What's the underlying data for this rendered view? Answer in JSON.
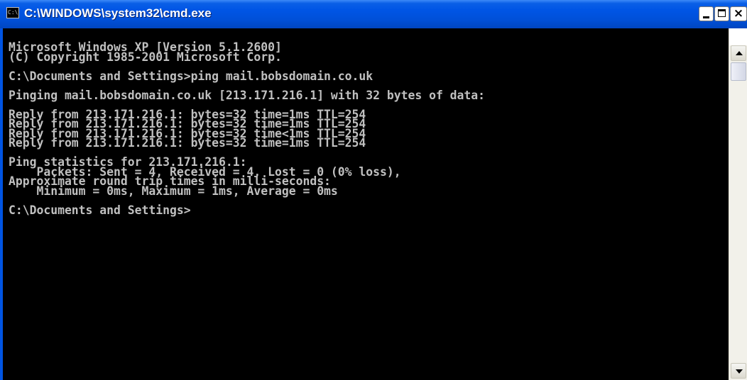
{
  "window": {
    "title": "C:\\WINDOWS\\system32\\cmd.exe",
    "icon": "cmd-icon",
    "icon_text": "C:\\",
    "buttons": {
      "minimize": "minimize-icon",
      "maximize": "maximize-icon",
      "close_label": "×"
    }
  },
  "console": {
    "lines": [
      "Microsoft Windows XP [Version 5.1.2600]",
      "(C) Copyright 1985-2001 Microsoft Corp.",
      "",
      "C:\\Documents and Settings>ping mail.bobsdomain.co.uk",
      "",
      "Pinging mail.bobsdomain.co.uk [213.171.216.1] with 32 bytes of data:",
      "",
      "Reply from 213.171.216.1: bytes=32 time=1ms TTL=254",
      "Reply from 213.171.216.1: bytes=32 time=1ms TTL=254",
      "Reply from 213.171.216.1: bytes=32 time<1ms TTL=254",
      "Reply from 213.171.216.1: bytes=32 time=1ms TTL=254",
      "",
      "Ping statistics for 213.171.216.1:",
      "    Packets: Sent = 4, Received = 4, Lost = 0 (0% loss),",
      "Approximate round trip times in milli-seconds:",
      "    Minimum = 0ms, Maximum = 1ms, Average = 0ms",
      "",
      "C:\\Documents and Settings>"
    ],
    "text_color": "#c0c0c0",
    "background": "#000000"
  },
  "scrollbar": {
    "up": "scroll-up-arrow-icon",
    "down": "scroll-down-arrow-icon"
  }
}
